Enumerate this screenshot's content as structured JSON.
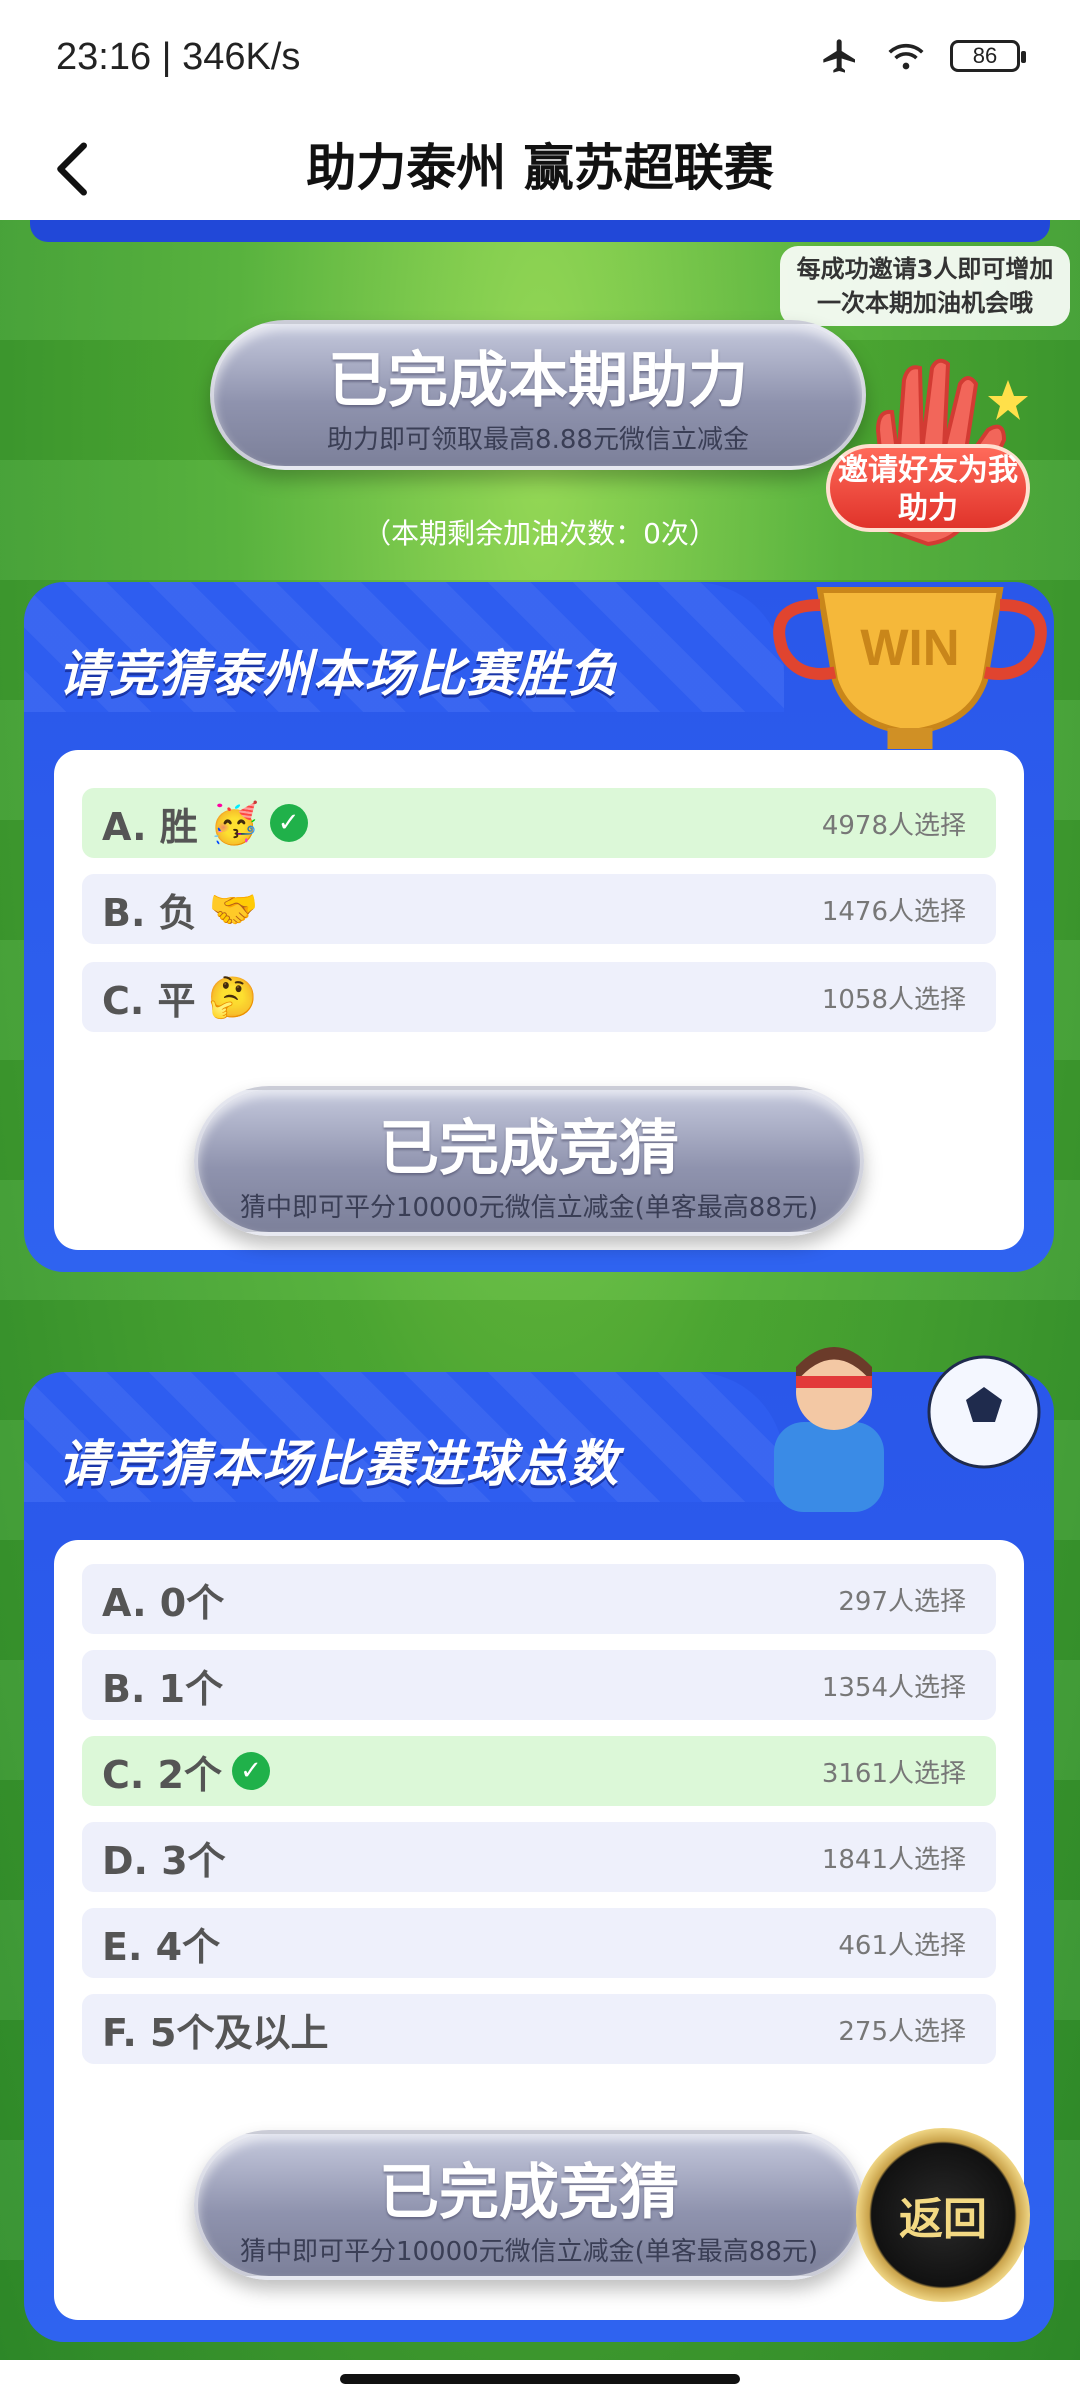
{
  "status_bar": {
    "time": "23:16 | 346K/s",
    "battery": "86"
  },
  "nav": {
    "title": "助力泰州 赢苏超联赛"
  },
  "hero": {
    "invite_tip": "每成功邀请3人即可增加一次本期加油机会哦",
    "help_button_main": "已完成本期助力",
    "help_button_sub": "助力即可领取最高8.88元微信立减金",
    "remaining": "（本期剩余加油次数：0次）",
    "invite_badge": "邀请好友为我助力"
  },
  "quiz1": {
    "title": "请竞猜泰州本场比赛胜负",
    "trophy_text": "WIN",
    "options": [
      {
        "label": "A. 胜",
        "emoji": "🥳",
        "count": "4978人选择",
        "selected": true
      },
      {
        "label": "B. 负",
        "emoji": "🤝",
        "count": "1476人选择",
        "selected": false
      },
      {
        "label": "C. 平",
        "emoji": "🤔",
        "count": "1058人选择",
        "selected": false
      }
    ],
    "button_main": "已完成竞猜",
    "button_sub": "猜中即可平分10000元微信立减金(单客最高88元)"
  },
  "quiz2": {
    "title": "请竞猜本场比赛进球总数",
    "options": [
      {
        "label": "A. 0个",
        "count": "297人选择",
        "selected": false
      },
      {
        "label": "B. 1个",
        "count": "1354人选择",
        "selected": false
      },
      {
        "label": "C. 2个",
        "count": "3161人选择",
        "selected": true
      },
      {
        "label": "D. 3个",
        "count": "1841人选择",
        "selected": false
      },
      {
        "label": "E. 4个",
        "count": "461人选择",
        "selected": false
      },
      {
        "label": "F. 5个及以上",
        "count": "275人选择",
        "selected": false
      }
    ],
    "button_main": "已完成竞猜",
    "button_sub": "猜中即可平分10000元微信立减金(单客最高88元)"
  },
  "return_button": "返回",
  "colors": {
    "card_blue": "#2a57ea",
    "selected_green": "#dcf8d8",
    "option_bg": "#eef0fb",
    "check_green": "#20b14a"
  }
}
